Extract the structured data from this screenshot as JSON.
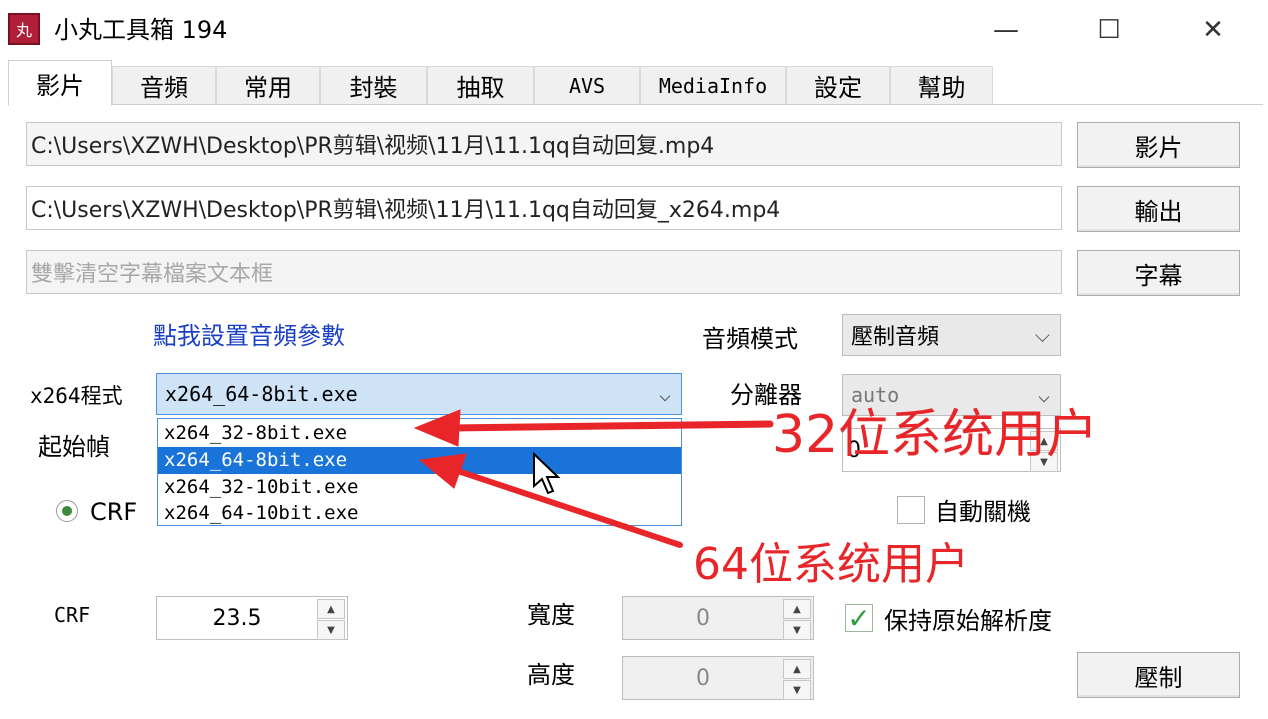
{
  "window": {
    "title": "小丸工具箱 194",
    "icon_glyph": "丸",
    "minimize": "—",
    "maximize": "☐",
    "close": "✕"
  },
  "tabs": [
    {
      "label": "影片",
      "active": true
    },
    {
      "label": "音頻"
    },
    {
      "label": "常用"
    },
    {
      "label": "封裝"
    },
    {
      "label": "抽取"
    },
    {
      "label": "AVS"
    },
    {
      "label": "MediaInfo"
    },
    {
      "label": "設定"
    },
    {
      "label": "幫助"
    }
  ],
  "video": {
    "input_path": "C:\\Users\\XZWH\\Desktop\\PR剪辑\\视频\\11月\\11.1qq自动回复.mp4",
    "output_path": "C:\\Users\\XZWH\\Desktop\\PR剪辑\\视频\\11月\\11.1qq自动回复_x264.mp4",
    "subtitle_placeholder": "雙擊清空字幕檔案文本框",
    "btn_video": "影片",
    "btn_output": "輸出",
    "btn_subtitle": "字幕",
    "audio_link": "點我設置音頻參數",
    "audio_mode_label": "音頻模式",
    "audio_mode_value": "壓制音頻",
    "x264_label": "x264程式",
    "x264_value": "x264_64-8bit.exe",
    "x264_options": [
      "x264_32-8bit.exe",
      "x264_64-8bit.exe",
      "x264_32-10bit.exe",
      "x264_64-10bit.exe"
    ],
    "separator_label": "分離器",
    "separator_value": "auto",
    "start_frame_label": "起始幀",
    "start_frame_value": "0",
    "crf_radio_label": "CRF",
    "auto_shutdown_label": "自動關機",
    "crf_label": "CRF",
    "crf_value": "23.5",
    "width_label": "寬度",
    "width_value": "0",
    "height_label": "高度",
    "height_value": "0",
    "keep_res_label": "保持原始解析度",
    "btn_encode": "壓制"
  },
  "annotations": {
    "label_32": "32位系统用户",
    "label_64": "64位系统用户",
    "color": "#e8262a"
  }
}
